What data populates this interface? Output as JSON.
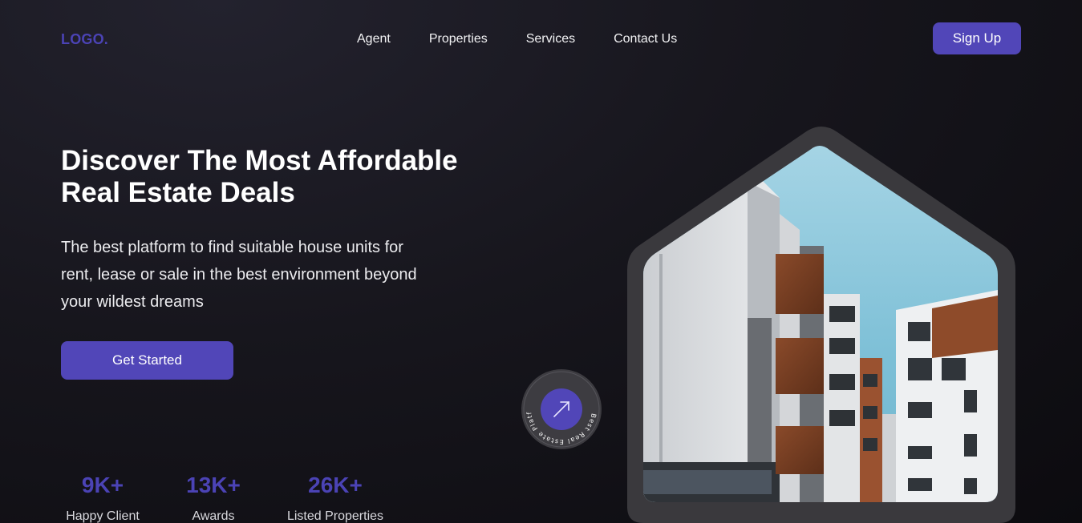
{
  "header": {
    "logo": "LOGO.",
    "nav": [
      "Agent",
      "Properties",
      "Services",
      "Contact Us"
    ],
    "signup_label": "Sign Up"
  },
  "hero": {
    "title_line1": "Discover The Most Affordable",
    "title_line2": "Real Estate Deals",
    "subtitle_line1": "The best platform to find suitable house units for",
    "subtitle_line2": "rent, lease or sale in the best environment beyond",
    "subtitle_line3": "your wildest dreams",
    "cta_label": "Get Started"
  },
  "stats": [
    {
      "value": "9K+",
      "label": "Happy Client"
    },
    {
      "value": "13K+",
      "label": "Awards"
    },
    {
      "value": "26K+",
      "label": "Listed Properties"
    }
  ],
  "badge": {
    "ring_text": "Best Real Estate Platform of the Year",
    "icon": "arrow-up-right-icon"
  },
  "colors": {
    "accent": "#5146b8",
    "logo": "#4b43b5",
    "background": "#17161d"
  }
}
